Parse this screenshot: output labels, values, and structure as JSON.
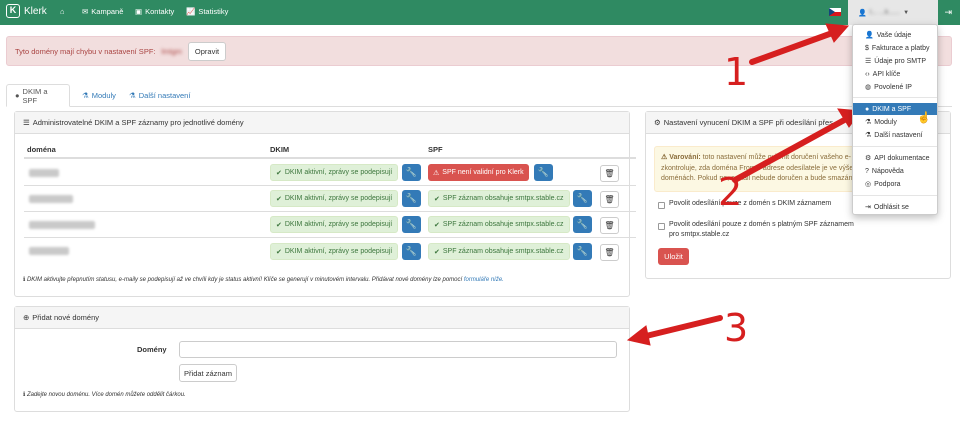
{
  "nav": {
    "brand": "Klerk",
    "items": [
      {
        "label": "",
        "icon": "home-icon"
      },
      {
        "label": "Kampaně",
        "icon": "envelope-icon"
      },
      {
        "label": "Kontakty",
        "icon": "contacts-icon"
      },
      {
        "label": "Statistiky",
        "icon": "chart-icon"
      }
    ],
    "user_label": "l...  ...k......",
    "language": "czech-flag-icon"
  },
  "alert": {
    "text": "Tyto domény mají chybu v nastavení SPF:",
    "domain_hidden": "lmtgm",
    "button": "Opravit"
  },
  "tabs": [
    {
      "label": "DKIM a SPF",
      "icon": "circle-icon",
      "active": true
    },
    {
      "label": "Moduly",
      "icon": "flask-icon"
    },
    {
      "label": "Další nastavení",
      "icon": "flask-icon"
    }
  ],
  "dkim_panel": {
    "title": "Administrovatelné DKIM a SPF záznamy pro jednotlivé domény",
    "columns": [
      "doména",
      "DKIM",
      "SPF"
    ],
    "rows": [
      {
        "dkim": "DKIM aktivní, zprávy se podepisují",
        "spf": "SPF není validní pro Klerk",
        "spf_ok": false
      },
      {
        "dkim": "DKIM aktivní, zprávy se podepisují",
        "spf": "SPF záznam obsahuje smtpx.stable.cz",
        "spf_ok": true
      },
      {
        "dkim": "DKIM aktivní, zprávy se podepisují",
        "spf": "SPF záznam obsahuje smtpx.stable.cz",
        "spf_ok": true
      },
      {
        "dkim": "DKIM aktivní, zprávy se podepisují",
        "spf": "SPF záznam obsahuje smtpx.stable.cz",
        "spf_ok": true
      }
    ],
    "note": "DKIM aktivujte přepnutím statusu, e-maily se podepisují až ve chvíli kdy je status aktivní! Klíče se generují v minutovém intervalu. Přidávat nové domény lze pomocí",
    "note_link": "formuláře níže."
  },
  "enforce_panel": {
    "title": "Nastavení vynucení DKIM a SPF při odesílání přes",
    "warning_label": "Varování:",
    "warning_lines": [
      "toto nastavení může ovlivnit doručení vašeho e-",
      "zkontroluje, zda doména From v adrese odesílatele je ve výše",
      "doménách. Pokud ne, e-mail nebude doručen a bude smazán"
    ],
    "checkbox1": "Povolit odesílání pouze z domén s DKIM záznamem",
    "checkbox2_line1": "Povolit odesílání pouze z domén s platným SPF záznamem",
    "checkbox2_line2": "pro smtpx.stable.cz",
    "save": "Uložit"
  },
  "add_panel": {
    "title": "Přidat nové domény",
    "label": "Domény",
    "input_value": "",
    "button": "Přidat záznam",
    "note": "Zadejte novou doménu. Více domén můžete oddělit čárkou."
  },
  "dropdown": {
    "group1": [
      {
        "label": "Vaše údaje",
        "icon": "user-icon"
      },
      {
        "label": "Fakturace a platby",
        "icon": "dollar-icon"
      },
      {
        "label": "Údaje pro SMTP",
        "icon": "list-icon"
      },
      {
        "label": "API klíče",
        "icon": "code-icon"
      },
      {
        "label": "Povolené IP",
        "icon": "globe-icon"
      }
    ],
    "group2": [
      {
        "label": "DKIM a SPF",
        "icon": "circle-icon",
        "active": true
      },
      {
        "label": "Moduly",
        "icon": "flask-icon"
      },
      {
        "label": "Další nastavení",
        "icon": "flask-icon"
      }
    ],
    "group3": [
      {
        "label": "API dokumentace",
        "icon": "gear-icon"
      },
      {
        "label": "Nápověda",
        "icon": "question-icon"
      },
      {
        "label": "Podpora",
        "icon": "lifebuoy-icon"
      }
    ],
    "group4": [
      {
        "label": "Odhlásit se",
        "icon": "logout-icon"
      }
    ]
  },
  "annotations": [
    "1",
    "2",
    "3"
  ],
  "colors": {
    "navbar": "#2f8a62",
    "primary": "#337ab7",
    "danger": "#d9534f",
    "arrow": "#d61f1f"
  }
}
